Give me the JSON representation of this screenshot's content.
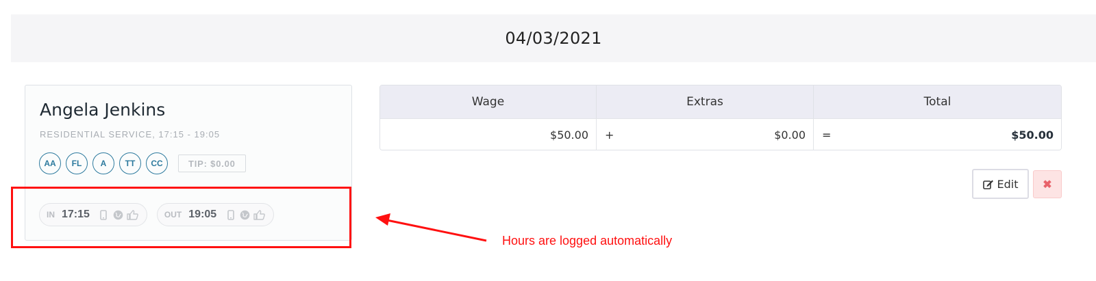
{
  "date_header": "04/03/2021",
  "employee": {
    "name": "Angela Jenkins",
    "service": "RESIDENTIAL SERVICE, 17:15 - 19:05",
    "badges": [
      "AA",
      "FL",
      "A",
      "TT",
      "CC"
    ],
    "tip": "TIP: $0.00",
    "clock_in": {
      "label": "IN",
      "time": "17:15",
      "icons": [
        "mobile-icon",
        "globe-icon",
        "thumbs-up-icon"
      ]
    },
    "clock_out": {
      "label": "OUT",
      "time": "19:05",
      "icons": [
        "mobile-icon",
        "globe-icon",
        "thumbs-up-icon"
      ]
    }
  },
  "wage_table": {
    "headers": [
      "Wage",
      "Extras",
      "Total"
    ],
    "row": {
      "wage": "$50.00",
      "plus": "+",
      "extras": "$0.00",
      "equals": "=",
      "total": "$50.00"
    }
  },
  "actions": {
    "edit_label": "Edit",
    "delete_symbol": "✖"
  },
  "annotation": {
    "text": "Hours are logged automatically",
    "color": "#ff1010"
  },
  "colors": {
    "badge": "#2d7a9e",
    "table_header_bg": "#ececf4",
    "delete_bg": "#fde4e4"
  }
}
